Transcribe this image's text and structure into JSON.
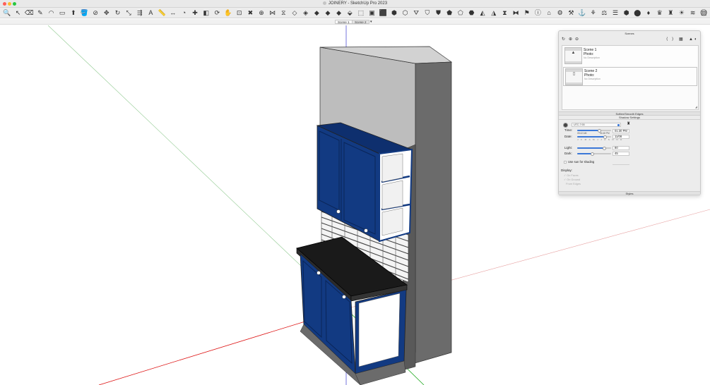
{
  "window": {
    "title": "JOINERY - SketchUp Pro 2023"
  },
  "toolbar": {
    "tools": [
      {
        "icon": "zoom-icon",
        "glyph": "🔍"
      },
      {
        "icon": "select-arrow-icon",
        "glyph": "↖"
      },
      {
        "icon": "eraser-icon",
        "glyph": "⌫"
      },
      {
        "icon": "line-pencil-icon",
        "glyph": "✎"
      },
      {
        "icon": "arc-icon",
        "glyph": "◠"
      },
      {
        "icon": "rectangle-icon",
        "glyph": "▭"
      },
      {
        "icon": "push-pull-icon",
        "glyph": "⬆"
      },
      {
        "icon": "paint-bucket-icon",
        "glyph": "🪣"
      },
      {
        "icon": "offset-icon",
        "glyph": "⊘"
      },
      {
        "icon": "move-icon",
        "glyph": "✥"
      },
      {
        "icon": "rotate-icon",
        "glyph": "↻"
      },
      {
        "icon": "scale-icon",
        "glyph": "⤡"
      },
      {
        "icon": "follow-me-icon",
        "glyph": "⇶"
      },
      {
        "icon": "text-icon",
        "glyph": "A"
      },
      {
        "icon": "tape-measure-icon",
        "glyph": "📏"
      },
      {
        "icon": "dimension-icon",
        "glyph": "↔"
      },
      {
        "icon": "protractor-icon",
        "glyph": "◔"
      },
      {
        "icon": "axes-icon",
        "glyph": "✚"
      },
      {
        "icon": "section-plane-icon",
        "glyph": "◧"
      },
      {
        "icon": "orbit-icon",
        "glyph": "⟳"
      },
      {
        "icon": "pan-icon",
        "glyph": "✋"
      },
      {
        "icon": "zoom-window-icon",
        "glyph": "⊡"
      },
      {
        "icon": "zoom-extents-icon",
        "glyph": "✖"
      },
      {
        "icon": "walk-icon",
        "glyph": "⊕"
      },
      {
        "icon": "x-ray-icon",
        "glyph": "⋈"
      },
      {
        "icon": "back-edges-icon",
        "glyph": "⧖"
      },
      {
        "icon": "wireframe-icon",
        "glyph": "◇"
      },
      {
        "icon": "hidden-line-icon",
        "glyph": "◈"
      },
      {
        "icon": "shaded-icon",
        "glyph": "◆"
      },
      {
        "icon": "shaded-texture-icon",
        "glyph": "◆"
      },
      {
        "icon": "monochrome-icon",
        "glyph": "◆"
      },
      {
        "icon": "iso-view-icon",
        "glyph": "⬙"
      },
      {
        "icon": "top-view-icon",
        "glyph": "⬚"
      },
      {
        "icon": "front-view-icon",
        "glyph": "▣"
      },
      {
        "icon": "right-view-icon",
        "glyph": "⬛"
      },
      {
        "icon": "back-view-icon",
        "glyph": "⬢"
      },
      {
        "icon": "left-view-icon",
        "glyph": "⬡"
      },
      {
        "icon": "sandbox-icon",
        "glyph": "⛛"
      },
      {
        "icon": "stamp-icon",
        "glyph": "⛉"
      },
      {
        "icon": "drape-icon",
        "glyph": "⛊"
      },
      {
        "icon": "smoove-icon",
        "glyph": "⬟"
      },
      {
        "icon": "add-detail-icon",
        "glyph": "⬠"
      },
      {
        "icon": "flip-edge-icon",
        "glyph": "⬣"
      },
      {
        "icon": "solid-union-icon",
        "glyph": "◭"
      },
      {
        "icon": "solid-subtract-icon",
        "glyph": "◮"
      },
      {
        "icon": "solid-trim-icon",
        "glyph": "⧗"
      },
      {
        "icon": "solid-split-icon",
        "glyph": "⧓"
      },
      {
        "icon": "location-icon",
        "glyph": "⚑"
      },
      {
        "icon": "model-info-icon",
        "glyph": "ⓘ"
      },
      {
        "icon": "warehouse-icon",
        "glyph": "⌂"
      },
      {
        "icon": "ext-manager-icon",
        "glyph": "⚙"
      },
      {
        "icon": "dynamic-comp-icon",
        "glyph": "⚒"
      },
      {
        "icon": "photo-match-icon",
        "glyph": "⚓"
      },
      {
        "icon": "styles-icon",
        "glyph": "⚘"
      },
      {
        "icon": "layers-icon",
        "glyph": "⚖"
      },
      {
        "icon": "outliner-icon",
        "glyph": "☰"
      },
      {
        "icon": "components-icon",
        "glyph": "⬢"
      },
      {
        "icon": "materials-icon",
        "glyph": "⬤"
      },
      {
        "icon": "entity-info-icon",
        "glyph": "♦"
      },
      {
        "icon": "ruby-console-icon",
        "glyph": "♛"
      },
      {
        "icon": "profile-builder-icon",
        "glyph": "♜"
      },
      {
        "icon": "sun-icon",
        "glyph": "☀"
      },
      {
        "icon": "fog-icon",
        "glyph": "≋"
      },
      {
        "icon": "section-fill-icon",
        "glyph": "▨"
      }
    ],
    "right_icon": "user-icon",
    "right_glyph": "◯"
  },
  "scene_tabs": {
    "tabs": [
      "Scene 1",
      "Scene 2"
    ],
    "arrow": "▾"
  },
  "tray": {
    "scenes_title": "Scenes",
    "scene_toolbar": {
      "refresh": "↻",
      "add": "⊕",
      "remove": "⊖",
      "move_up": "⟨",
      "move_down": "⟩",
      "view_options": "▦",
      "lock": "▲",
      "details": "◐"
    },
    "scenes": [
      {
        "name": "Scene 1",
        "photo": "Photo:",
        "description": "No Description",
        "thumb": "▲"
      },
      {
        "name": "Scene 2",
        "photo": "Photo:",
        "description": "No Description",
        "thumb": "▯"
      }
    ],
    "soften_title": "Soften/Smooth Edges",
    "shadow_title": "Shadow Settings",
    "shadow": {
      "timezone": "UTC-7:00",
      "time_label": "Time:",
      "time_value": "01:30 PM",
      "time_min": "05:42 AM",
      "time_max": "04:48 PM",
      "time_fraction": 0.65,
      "date_label": "Date:",
      "date_value": "11/08",
      "date_fraction": 0.82,
      "months": "J F M A M J J A S O N D",
      "light_label": "Light:",
      "light_value": "80",
      "light_fraction": 0.8,
      "dark_label": "Dark:",
      "dark_value": "45",
      "dark_fraction": 0.45,
      "use_sun": "Use sun for shading",
      "display_title": "Display:",
      "display_options": [
        "On Faces",
        "On Ground",
        "From Edges"
      ]
    },
    "styles_title": "Styles"
  },
  "colors": {
    "cabinet_blue": "#123a82",
    "countertop": "#1a1a1a",
    "wall": "#6b6b6b",
    "upper_wall": "#bdbdbd",
    "accent": "#3b78d8"
  }
}
